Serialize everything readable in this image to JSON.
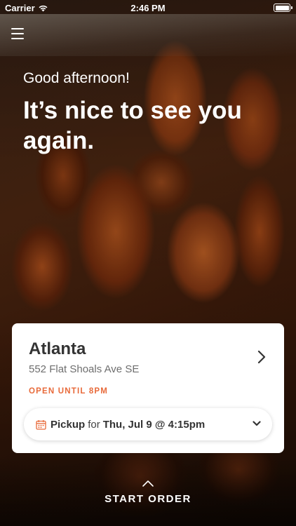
{
  "status_bar": {
    "carrier": "Carrier",
    "time": "2:46 PM",
    "wifi_icon": "wifi-icon",
    "battery_icon": "battery-icon"
  },
  "menu": {
    "icon": "hamburger-menu-icon"
  },
  "hero": {
    "greeting": "Good afternoon!",
    "headline": "It’s nice to see you again."
  },
  "store_card": {
    "city": "Atlanta",
    "address": "552 Flat Shoals Ave SE",
    "hours": "OPEN UNTIL 8PM",
    "chevron_icon": "chevron-right-icon",
    "pickup": {
      "icon": "calendar-icon",
      "mode": "Pickup",
      "connector": "for",
      "datetime": "Thu, Jul 9 @ 4:15pm",
      "dropdown_icon": "chevron-down-icon"
    }
  },
  "footer": {
    "start_label": "START ORDER",
    "up_icon": "chevron-up-icon"
  },
  "colors": {
    "accent": "#e86a3a",
    "card_bg": "#ffffff",
    "text_dark": "#333333",
    "text_muted": "#6e6e6e"
  }
}
